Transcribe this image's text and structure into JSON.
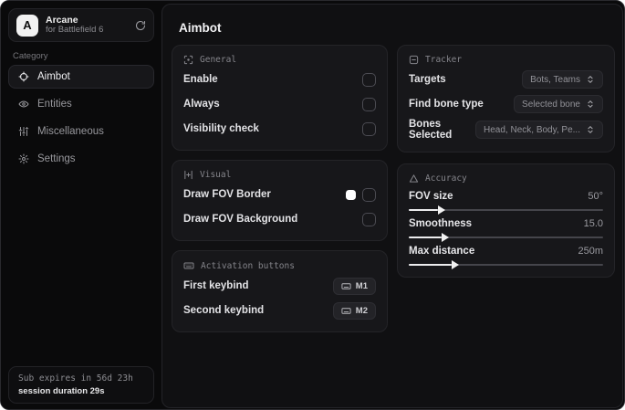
{
  "app": {
    "name": "Arcane",
    "subtitle": "for Battlefield 6",
    "logo_letter": "A"
  },
  "sidebar": {
    "category_label": "Category",
    "items": [
      {
        "label": "Aimbot",
        "icon": "crosshair-icon",
        "active": true
      },
      {
        "label": "Entities",
        "icon": "entities-icon",
        "active": false
      },
      {
        "label": "Miscellaneous",
        "icon": "sliders-icon",
        "active": false
      },
      {
        "label": "Settings",
        "icon": "gear-icon",
        "active": false
      }
    ],
    "footer": {
      "sub_expiry": "Sub expires in 56d 23h",
      "session_duration": "session duration 29s"
    }
  },
  "main": {
    "title": "Aimbot",
    "general": {
      "title": "General",
      "rows": [
        {
          "label": "Enable",
          "checked": false
        },
        {
          "label": "Always",
          "checked": false
        },
        {
          "label": "Visibility check",
          "checked": false
        }
      ]
    },
    "visual": {
      "title": "Visual",
      "rows": [
        {
          "label": "Draw FOV Border",
          "swatch_color": "#ffffff",
          "checked": false
        },
        {
          "label": "Draw FOV Background",
          "checked": false
        }
      ]
    },
    "activation": {
      "title": "Activation buttons",
      "rows": [
        {
          "label": "First keybind",
          "key": "M1"
        },
        {
          "label": "Second keybind",
          "key": "M2"
        }
      ]
    },
    "tracker": {
      "title": "Tracker",
      "rows": [
        {
          "label": "Targets",
          "value": "Bots, Teams"
        },
        {
          "label": "Find bone type",
          "value": "Selected bone"
        },
        {
          "label": "Bones Selected",
          "value": "Head, Neck, Body, Pe..."
        }
      ]
    },
    "accuracy": {
      "title": "Accuracy",
      "rows": [
        {
          "label": "FOV size",
          "value": "50°",
          "percent": 15
        },
        {
          "label": "Smoothness",
          "value": "15.0",
          "percent": 17
        },
        {
          "label": "Max distance",
          "value": "250m",
          "percent": 22
        }
      ]
    }
  },
  "colors": {
    "window_bg": "#0a0a0b",
    "panel_bg": "#101012",
    "card_bg": "#17171a",
    "accent_fill": "#ececee",
    "fov_border_swatch": "#ffffff"
  }
}
